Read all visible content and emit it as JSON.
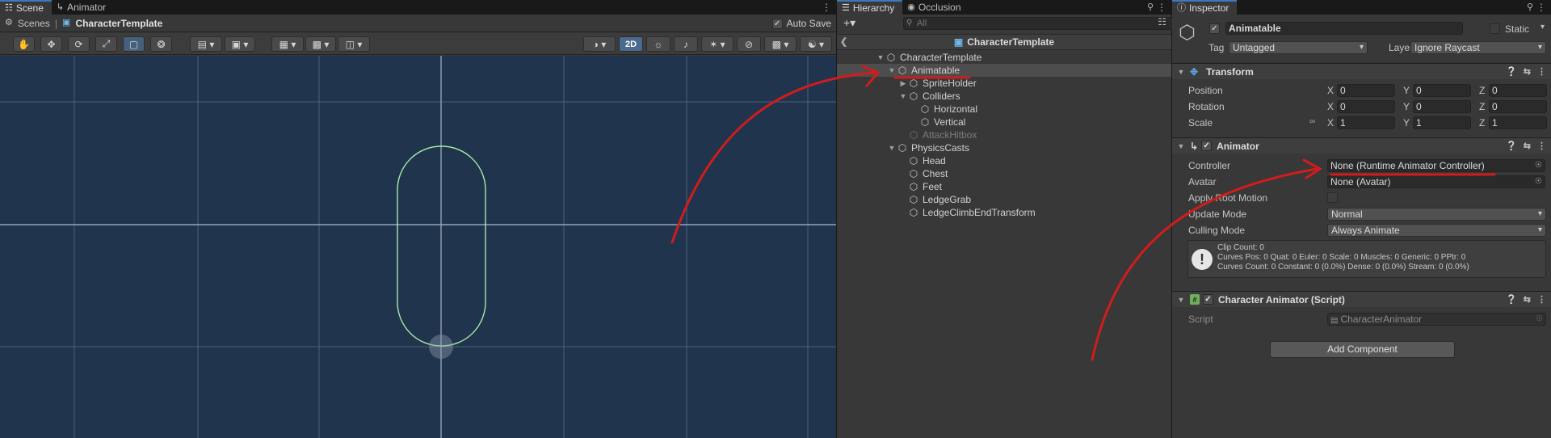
{
  "scene": {
    "tabs": [
      {
        "label": "Scene"
      },
      {
        "label": "Animator"
      }
    ],
    "breadcrumb": {
      "root": "Scenes",
      "current": "CharacterTemplate"
    },
    "auto_save_label": "Auto Save",
    "mode_2d_label": "2D"
  },
  "hierarchy": {
    "tabs": [
      {
        "label": "Hierarchy"
      },
      {
        "label": "Occlusion"
      }
    ],
    "search_placeholder": "All",
    "scene_name": "CharacterTemplate",
    "items": [
      {
        "label": "CharacterTemplate"
      },
      {
        "label": "Animatable"
      },
      {
        "label": "SpriteHolder"
      },
      {
        "label": "Colliders"
      },
      {
        "label": "Horizontal"
      },
      {
        "label": "Vertical"
      },
      {
        "label": "AttackHitbox"
      },
      {
        "label": "PhysicsCasts"
      },
      {
        "label": "Head"
      },
      {
        "label": "Chest"
      },
      {
        "label": "Feet"
      },
      {
        "label": "LedgeGrab"
      },
      {
        "label": "LedgeClimbEndTransform"
      }
    ]
  },
  "inspector": {
    "tab": "Inspector",
    "object_name": "Animatable",
    "static_label": "Static",
    "tag_label": "Tag",
    "tag_value": "Untagged",
    "layer_label": "Layer",
    "layer_value": "Ignore Raycast",
    "transform": {
      "title": "Transform",
      "rows": [
        {
          "label": "Position",
          "x": "0",
          "y": "0",
          "z": "0"
        },
        {
          "label": "Rotation",
          "x": "0",
          "y": "0",
          "z": "0"
        },
        {
          "label": "Scale",
          "x": "1",
          "y": "1",
          "z": "1"
        }
      ]
    },
    "animator": {
      "title": "Animator",
      "controller_label": "Controller",
      "controller_value": "None (Runtime Animator Controller)",
      "avatar_label": "Avatar",
      "avatar_value": "None (Avatar)",
      "apply_root_motion_label": "Apply Root Motion",
      "update_mode_label": "Update Mode",
      "update_mode_value": "Normal",
      "culling_mode_label": "Culling Mode",
      "culling_mode_value": "Always Animate",
      "info": [
        "Clip Count: 0",
        "Curves Pos: 0 Quat: 0 Euler: 0 Scale: 0 Muscles: 0 Generic: 0 PPtr: 0",
        "Curves Count: 0 Constant: 0 (0.0%) Dense: 0 (0.0%) Stream: 0 (0.0%)"
      ]
    },
    "script_component": {
      "title": "Character Animator (Script)",
      "script_label": "Script",
      "script_value": "CharacterAnimator"
    },
    "add_component_label": "Add Component",
    "x": "X",
    "y": "Y",
    "z": "Z"
  },
  "colors": {
    "annotation": "#d21c1c",
    "selection": "#3a79bb",
    "viewport": "#20344d"
  }
}
